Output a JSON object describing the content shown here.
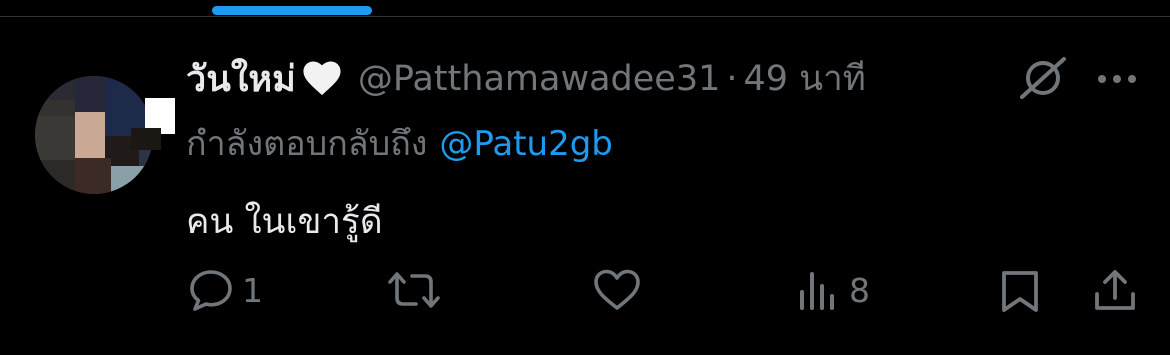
{
  "tweet": {
    "display_name": "วันใหม่",
    "handle": "@Patthamawadee31",
    "separator": "·",
    "time": "49 นาที",
    "reply_prefix": "กำลังตอบกลับถึง",
    "reply_to": "@Patu2gb",
    "text": "คน ในเขารู้ดี"
  },
  "actions": {
    "reply_count": "1",
    "views_count": "8"
  },
  "colors": {
    "background": "#000000",
    "text_primary": "#e7e9ea",
    "text_secondary": "#71767b",
    "accent": "#1d9bf0"
  },
  "icons": [
    "white-heart-icon",
    "grok-icon",
    "more-icon",
    "reply-icon",
    "retweet-icon",
    "like-icon",
    "views-icon",
    "bookmark-icon",
    "share-icon"
  ]
}
